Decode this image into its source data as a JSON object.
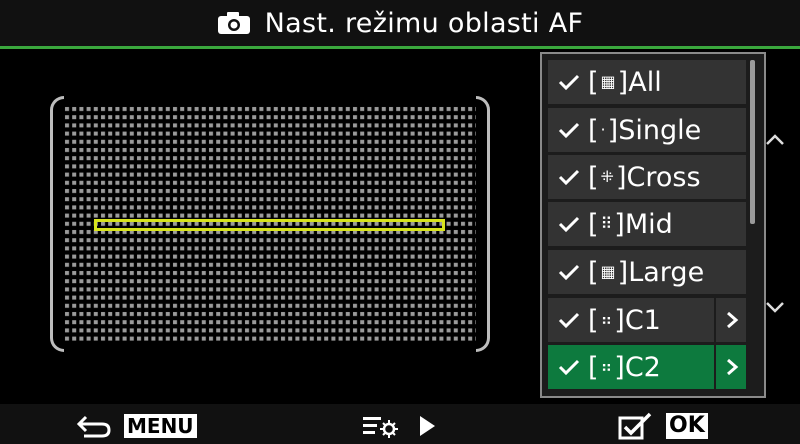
{
  "header": {
    "title": "Nast. režimu oblasti AF",
    "icon": "camera-icon"
  },
  "colors": {
    "accent": "#3aa83d",
    "af_frame": "#d7e41d",
    "selected_bg": "#0d7a3e"
  },
  "af_modes": [
    {
      "bracket": "[",
      "glyph": "▦",
      "close": "]",
      "name": "All",
      "checked": true,
      "has_submenu": false
    },
    {
      "bracket": "[",
      "glyph": "·",
      "close": "]",
      "name": "Single",
      "checked": true,
      "has_submenu": false
    },
    {
      "bracket": "[",
      "glyph": "⁜",
      "close": "]",
      "name": "Cross",
      "checked": true,
      "has_submenu": false
    },
    {
      "bracket": "[",
      "glyph": "⠿",
      "close": "]",
      "name": "Mid",
      "checked": true,
      "has_submenu": false
    },
    {
      "bracket": "[",
      "glyph": "▦",
      "close": "]",
      "name": "Large",
      "checked": true,
      "has_submenu": false
    },
    {
      "bracket": "[",
      "glyph": "⠶",
      "close": "]",
      "name": "C1",
      "checked": true,
      "has_submenu": true
    },
    {
      "bracket": "[",
      "glyph": "⠶",
      "close": "]",
      "name": "C2",
      "checked": true,
      "has_submenu": true,
      "selected": true
    }
  ],
  "footer": {
    "back_label": "MENU",
    "ok_label": "OK"
  }
}
